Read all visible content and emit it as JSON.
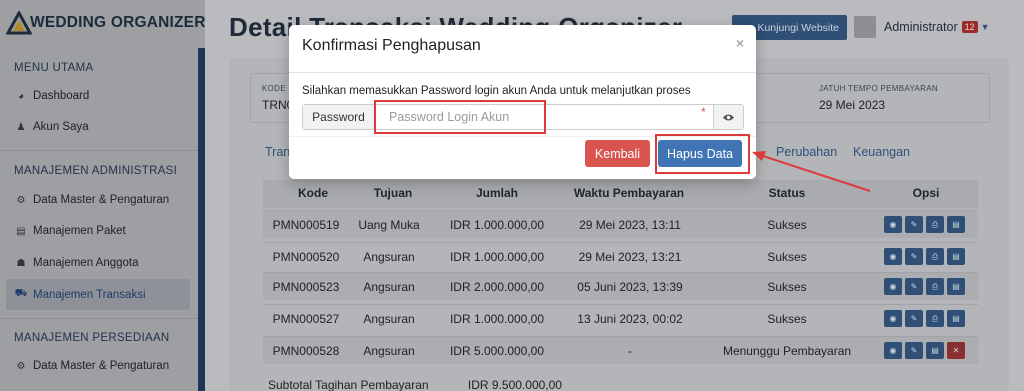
{
  "brand": {
    "name": "WEDDING ORGANIZER"
  },
  "sidebar": {
    "sections": [
      {
        "title": "MENU UTAMA"
      },
      {
        "title": "MANAJEMEN ADMINISTRASI"
      },
      {
        "title": "MANAJEMEN PERSEDIAAN"
      }
    ],
    "items": [
      {
        "label": "Dashboard",
        "icon": "dashboard-icon"
      },
      {
        "label": "Akun Saya",
        "icon": "user-icon"
      },
      {
        "label": "Data Master & Pengaturan",
        "icon": "gears-icon"
      },
      {
        "label": "Manajemen Paket",
        "icon": "book-icon"
      },
      {
        "label": "Manajemen Anggota",
        "icon": "users-icon"
      },
      {
        "label": "Manajemen Transaksi",
        "icon": "cart-icon"
      },
      {
        "label": "Data Master & Pengaturan",
        "icon": "gears-icon"
      }
    ]
  },
  "header": {
    "title": "Detail Transaksi Wedding Organizer",
    "visit_label": "Kunjungi Website",
    "user_name": "Administrator",
    "notif_count": "12"
  },
  "info": {
    "code_label": "KODE",
    "code_value": "TRN0",
    "due_label": "JATUH TEMPO PEMBAYARAN",
    "due_value": "29 Mei 2023"
  },
  "tabs": {
    "t1": "Tran",
    "t2": "Perubahan",
    "t3": "Keuangan"
  },
  "table": {
    "headers": [
      "Kode",
      "Tujuan",
      "Jumlah",
      "Waktu Pembayaran",
      "Status",
      "Opsi"
    ],
    "rows": [
      {
        "kode": "PMN000519",
        "tujuan": "Uang Muka",
        "jumlah": "IDR 1.000.000,00",
        "waktu": "29 Mei 2023, 13:11",
        "status": "Sukses"
      },
      {
        "kode": "PMN000520",
        "tujuan": "Angsuran",
        "jumlah": "IDR 1.000.000,00",
        "waktu": "29 Mei 2023, 13:21",
        "status": "Sukses"
      },
      {
        "kode": "PMN000523",
        "tujuan": "Angsuran",
        "jumlah": "IDR 2.000.000,00",
        "waktu": "05 Juni 2023, 13:39",
        "status": "Sukses"
      },
      {
        "kode": "PMN000527",
        "tujuan": "Angsuran",
        "jumlah": "IDR 1.000.000,00",
        "waktu": "13 Juni 2023, 00:02",
        "status": "Sukses"
      },
      {
        "kode": "PMN000528",
        "tujuan": "Angsuran",
        "jumlah": "IDR 5.000.000,00",
        "waktu": "-",
        "status": "Menunggu Pembayaran"
      }
    ],
    "subtotal_label": "Subtotal Tagihan Pembayaran",
    "subtotal_value": "IDR 9.500.000,00"
  },
  "modal": {
    "title": "Konfirmasi Penghapusan",
    "close": "×",
    "message": "Silahkan memasukkan Password login akun Anda untuk melanjutkan proses",
    "password_label": "Password",
    "password_placeholder": "Password Login Akun",
    "password_value": "",
    "required_mark": "*",
    "back_label": "Kembali",
    "delete_label": "Hapus Data"
  },
  "colors": {
    "primary": "#4174b5",
    "danger": "#d9534f",
    "annotation": "#dd3b3b"
  }
}
